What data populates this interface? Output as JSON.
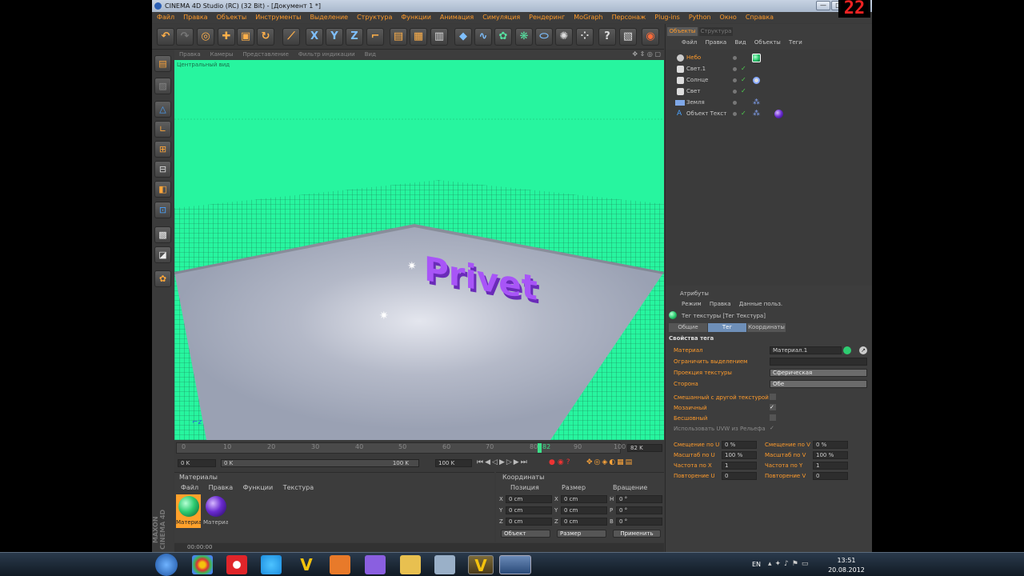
{
  "window": {
    "title": "CINEMA 4D Studio (RC) (32 Bit) - [Документ 1 *]",
    "min": "—",
    "max": "□",
    "close": "✕"
  },
  "menu": [
    "Файл",
    "Правка",
    "Объекты",
    "Инструменты",
    "Выделение",
    "Структура",
    "Функции",
    "Анимация",
    "Симуляция",
    "Рендеринг",
    "MoGraph",
    "Персонаж",
    "Plug-ins",
    "Python",
    "Окно",
    "Справка"
  ],
  "viewport": {
    "menu": [
      "Правка",
      "Камеры",
      "Представление",
      "Фильтр индикации",
      "Вид"
    ],
    "label": "Центральный вид",
    "text3d": "Privet",
    "colors": {
      "sky": "#27f59f",
      "floor": "#9aa1b3",
      "text": "#a855f7"
    }
  },
  "timeline": {
    "ticks": [
      "0",
      "10",
      "20",
      "30",
      "40",
      "50",
      "60",
      "70",
      "80",
      "90",
      "100"
    ],
    "current_frame": "82",
    "frame_box": "82 K",
    "start": "0 K",
    "min": "0 K",
    "max": "100 K",
    "end": "100 K"
  },
  "materials": {
    "title": "Материалы",
    "menu": [
      "Файл",
      "Правка",
      "Функции",
      "Текстура"
    ],
    "items": [
      {
        "label": "Материал",
        "color": "#2ecc71"
      },
      {
        "label": "Материал",
        "color": "#6a2bd1"
      }
    ]
  },
  "coords": {
    "title": "Координаты",
    "headers": [
      "Позиция",
      "Размер",
      "Вращение"
    ],
    "rows": [
      {
        "a": "X",
        "pos": "0 cm",
        "b": "X",
        "size": "0 cm",
        "c": "H",
        "rot": "0 °"
      },
      {
        "a": "Y",
        "pos": "0 cm",
        "b": "Y",
        "size": "0 cm",
        "c": "P",
        "rot": "0 °"
      },
      {
        "a": "Z",
        "pos": "0 cm",
        "b": "Z",
        "size": "0 cm",
        "c": "B",
        "rot": "0 °"
      }
    ],
    "mode1": "Объект",
    "mode2": "Размер",
    "apply": "Применить"
  },
  "status": "00:00:00",
  "maxon": "MAXON CINEMA 4D",
  "objects": {
    "tabs": [
      "Объекты",
      "Структура"
    ],
    "menu": [
      "Файл",
      "Правка",
      "Вид",
      "Объекты",
      "Теги"
    ],
    "items": [
      {
        "name": "Небо",
        "active": true
      },
      {
        "name": "Свет.1",
        "active": false
      },
      {
        "name": "Солнце",
        "active": false
      },
      {
        "name": "Свет",
        "active": false
      },
      {
        "name": "Земля",
        "active": false
      },
      {
        "name": "Объект Текст",
        "active": false
      }
    ]
  },
  "attributes": {
    "title": "Атрибуты",
    "menu": [
      "Режим",
      "Правка",
      "Данные польз."
    ],
    "tag_title": "Тег текстуры [Тег Текстура]",
    "tabs": [
      "Общие",
      "Тег",
      "Координаты"
    ],
    "section": "Свойства тега",
    "material_label": "Материал",
    "material_value": "Материал.1",
    "restrict_label": "Ограничить выделением",
    "projection_label": "Проекция текстуры",
    "projection_value": "Сферическая",
    "side_label": "Сторона",
    "side_value": "Обе",
    "mix_label": "Смешанный с другой текстурой",
    "tile_label": "Мозаичный",
    "seamless_label": "Бесшовный",
    "uvw_label": "Использовать UVW из Рельефа",
    "offset_u_label": "Смещение по U",
    "offset_u": "0 %",
    "offset_v_label": "Смещение по V",
    "offset_v": "0 %",
    "scale_u_label": "Масштаб по U",
    "scale_u": "100 %",
    "scale_v_label": "Масштаб по V",
    "scale_v": "100 %",
    "freq_x_label": "Частота по X",
    "freq_x": "1",
    "freq_y_label": "Частота по Y",
    "freq_y": "1",
    "rep_u_label": "Повторение U",
    "rep_u": "0",
    "rep_v_label": "Повторение V",
    "rep_v": "0"
  },
  "corner_counter": "22",
  "tray": {
    "lang": "EN",
    "time": "13:51",
    "date": "20.08.2012"
  }
}
